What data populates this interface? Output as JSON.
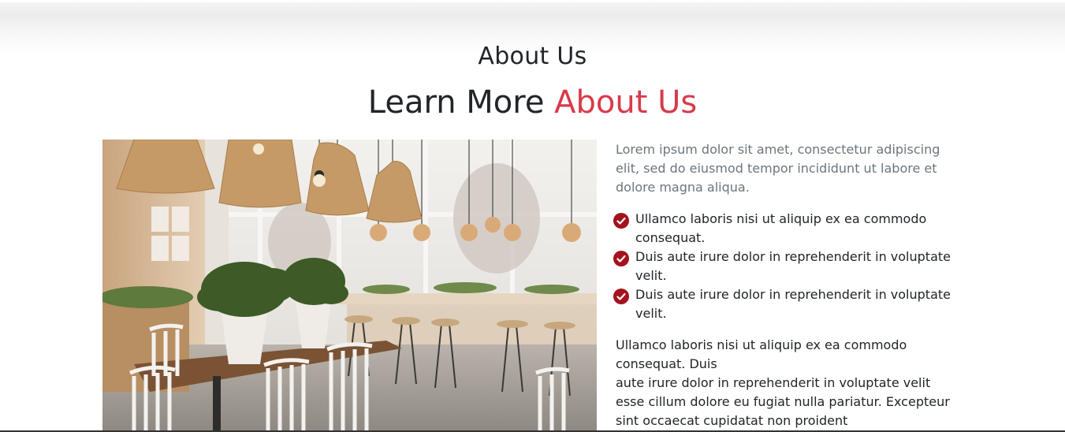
{
  "colors": {
    "accent": "#d83a4a",
    "check": "#a3131d"
  },
  "about": {
    "title": "About Us",
    "subtitle_prefix": "Learn More",
    "subtitle_accent": "About Us",
    "image_icon": "cafe-interior-photo",
    "intro": "Lorem ipsum dolor sit amet, consectetur adipiscing elit, sed do eiusmod tempor incididunt ut labore et dolore magna aliqua.",
    "checklist": [
      {
        "icon": "check-circle-icon",
        "text": "Ullamco laboris nisi ut aliquip ex ea commodo consequat."
      },
      {
        "icon": "check-circle-icon",
        "text": "Duis aute irure dolor in reprehenderit in voluptate velit."
      },
      {
        "icon": "check-circle-icon",
        "text": "Duis aute irure dolor in reprehenderit in voluptate velit."
      }
    ],
    "body_line1": "Ullamco laboris nisi ut aliquip ex ea commodo consequat. Duis",
    "body_line2": "aute irure dolor in reprehenderit in voluptate velit esse cillum dolore eu fugiat nulla pariatur. Excepteur sint occaecat cupidatat non proident"
  }
}
